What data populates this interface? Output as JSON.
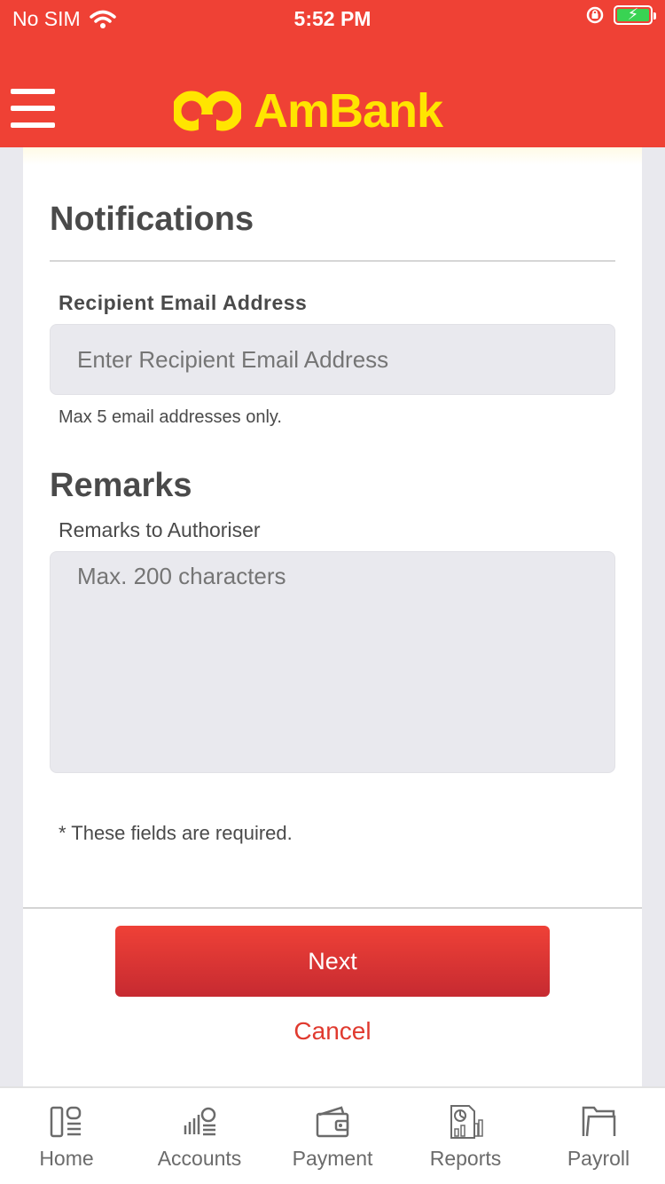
{
  "status_bar": {
    "carrier": "No SIM",
    "time": "5:52 PM"
  },
  "header": {
    "brand_name": "AmBank",
    "brand_color": "#ffe500",
    "bar_color": "#ef4135"
  },
  "notifications": {
    "title": "Notifications",
    "email_label": "Recipient Email Address",
    "email_placeholder": "Enter Recipient Email Address",
    "email_value": "",
    "email_hint": "Max 5 email addresses only."
  },
  "remarks": {
    "title": "Remarks",
    "label": "Remarks to Authoriser",
    "placeholder": "Max. 200 characters",
    "value": "",
    "required_note": "* These fields are required."
  },
  "actions": {
    "next_label": "Next",
    "cancel_label": "Cancel"
  },
  "tabs": [
    {
      "label": "Home",
      "icon": "home-icon"
    },
    {
      "label": "Accounts",
      "icon": "accounts-icon"
    },
    {
      "label": "Payment",
      "icon": "wallet-icon"
    },
    {
      "label": "Reports",
      "icon": "reports-icon"
    },
    {
      "label": "Payroll",
      "icon": "folder-icon"
    }
  ]
}
